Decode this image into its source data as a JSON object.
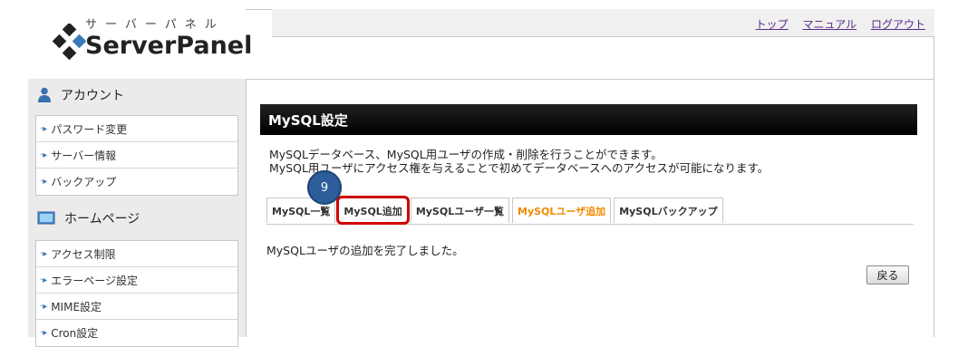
{
  "logo": {
    "kana": "サーバーパネル",
    "name": "ServerPanel"
  },
  "header": {
    "links": [
      "トップ",
      "マニュアル",
      "ログアウト"
    ],
    "link_color": "#5a2a8a"
  },
  "sidebar": {
    "sections": [
      {
        "title": "アカウント",
        "icon": "user-icon",
        "items": [
          "パスワード変更",
          "サーバー情報",
          "バックアップ"
        ]
      },
      {
        "title": "ホームページ",
        "icon": "monitor-icon",
        "items": [
          "アクセス制限",
          "エラーページ設定",
          "MIME設定",
          "Cron設定"
        ]
      }
    ]
  },
  "content": {
    "title": "MySQL設定",
    "description": [
      "MySQLデータベース、MySQL用ユーザの作成・削除を行うことができます。",
      "MySQL用ユーザにアクセス権を与えることで初めてデータベースへのアクセスが可能になります。"
    ],
    "tabs": [
      "MySQL一覧",
      "MySQL追加",
      "MySQLユーザ一覧",
      "MySQLユーザ追加",
      "MySQLバックアップ"
    ],
    "active_tab": "MySQLユーザ追加",
    "highlighted_tab": "MySQL追加",
    "step_badge": "9",
    "message": "MySQLユーザの追加を完了しました。",
    "back_button": "戻る"
  },
  "colors": {
    "active_tab": "#f08a00",
    "highlight": "#d00000",
    "badge": "#2d5d9a"
  }
}
